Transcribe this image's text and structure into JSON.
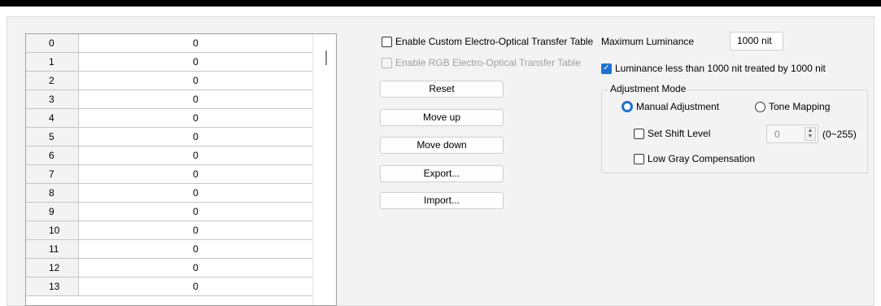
{
  "table": {
    "rows": [
      {
        "index": "0",
        "value": "0"
      },
      {
        "index": "1",
        "value": "0"
      },
      {
        "index": "2",
        "value": "0"
      },
      {
        "index": "3",
        "value": "0"
      },
      {
        "index": "4",
        "value": "0"
      },
      {
        "index": "5",
        "value": "0"
      },
      {
        "index": "6",
        "value": "0"
      },
      {
        "index": "7",
        "value": "0"
      },
      {
        "index": "8",
        "value": "0"
      },
      {
        "index": "9",
        "value": "0"
      },
      {
        "index": "10",
        "value": "0"
      },
      {
        "index": "11",
        "value": "0"
      },
      {
        "index": "12",
        "value": "0"
      },
      {
        "index": "13",
        "value": "0"
      }
    ]
  },
  "options": {
    "enable_custom_eotf": {
      "label": "Enable Custom Electro-Optical Transfer Table",
      "checked": false,
      "enabled": true
    },
    "enable_rgb_eotf": {
      "label": "Enable RGB Electro-Optical Transfer Table",
      "checked": false,
      "enabled": false
    }
  },
  "buttons": {
    "reset": "Reset",
    "move_up": "Move up",
    "move_down": "Move down",
    "export": "Export...",
    "import": "Import..."
  },
  "luminance": {
    "label": "Maximum Luminance",
    "value": "1000 nit",
    "treat_label": "Luminance less than 1000 nit treated by 1000 nit",
    "treat_checked": true
  },
  "adjustment": {
    "title": "Adjustment Mode",
    "manual_label": "Manual Adjustment",
    "tone_label": "Tone Mapping",
    "selected": "manual",
    "shift_label": "Set Shift Level",
    "shift_value": "0",
    "shift_range": "(0~255)",
    "low_gray_label": "Low Gray Compensation"
  },
  "colors": {
    "accent": "#1a73d4"
  }
}
